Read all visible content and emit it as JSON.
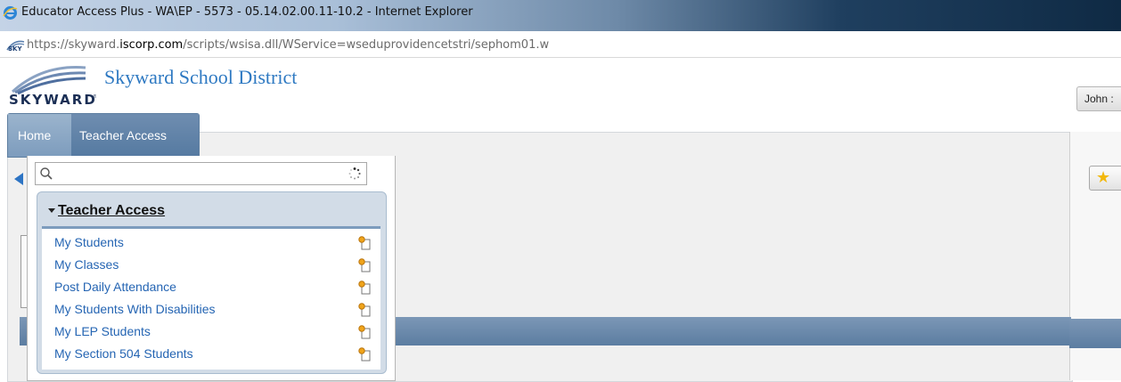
{
  "window": {
    "title": "Educator Access Plus - WA\\EP - 5573 - 05.14.02.00.11-10.2 - Internet Explorer"
  },
  "address_bar": {
    "url_prefix": "https://skyward.",
    "url_domain": "iscorp.com",
    "url_suffix": "/scripts/wsisa.dll/WService=wseduprovidencetstri/sephom01.w"
  },
  "header": {
    "logo_text": "SKYWARD",
    "district_name": "Skyward School District",
    "user_name": "John :"
  },
  "nav": {
    "tabs": [
      {
        "label": "Home"
      },
      {
        "label": "Teacher Access"
      }
    ]
  },
  "search": {
    "value": "",
    "placeholder": ""
  },
  "menu": {
    "group_title": "Teacher Access",
    "items": [
      {
        "label": "My Students"
      },
      {
        "label": "My Classes"
      },
      {
        "label": "Post Daily Attendance"
      },
      {
        "label": "My Students With Disabilities"
      },
      {
        "label": "My LEP Students"
      },
      {
        "label": "My Section 504 Students"
      }
    ]
  },
  "colors": {
    "link": "#2565b3",
    "nav_tab": "#6c8eb1",
    "district_title": "#2e79c2",
    "accent_star": "#f2b80c"
  }
}
